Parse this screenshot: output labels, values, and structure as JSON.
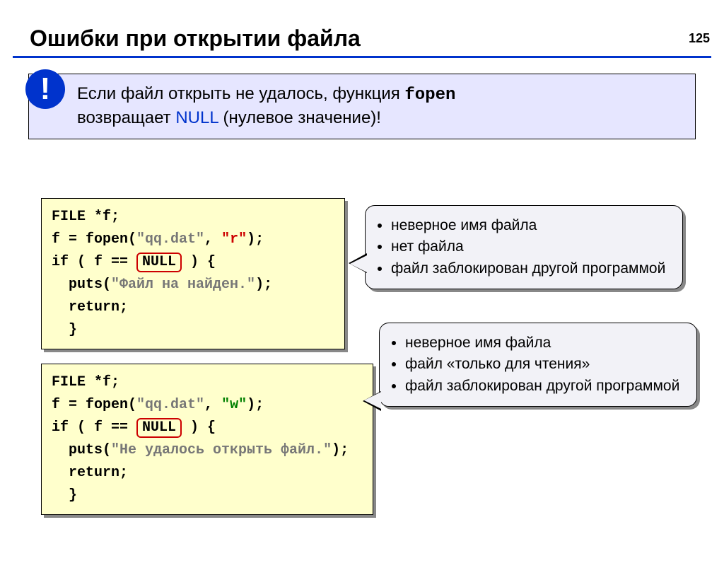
{
  "page_number": "125",
  "title": "Ошибки при открытии файла",
  "alert": {
    "badge": "!",
    "prefix": "Если файл открыть не удалось, функция ",
    "func": "fopen",
    "mid1": "возвращает ",
    "null_word": "NULL",
    "suffix": " (нулевое значение)!"
  },
  "code1": {
    "l1": "FILE *f;",
    "l2a": "f = fopen(",
    "l2q": "\"qq.dat\"",
    "l2c": ", ",
    "l2m": "\"r\"",
    "l2e": ");",
    "l3a": "if ( f == ",
    "l3n": "NULL",
    "l3e": " ) {",
    "l4a": "  puts(",
    "l4q": "\"Файл на найден.\"",
    "l4e": ");",
    "l5": "  return;",
    "l6": "  }"
  },
  "code2": {
    "l1": "FILE *f;",
    "l2a": "f = fopen(",
    "l2q": "\"qq.dat\"",
    "l2c": ", ",
    "l2m": "\"w\"",
    "l2e": ");",
    "l3a": "if ( f == ",
    "l3n": "NULL",
    "l3e": " ) {",
    "l4a": "  puts(",
    "l4q": "\"Не удалось открыть файл.\"",
    "l4e": ");",
    "l5": "  return;",
    "l6": "  }"
  },
  "callout1": {
    "items": [
      "неверное имя файла",
      "нет файла",
      "файл заблокирован другой программой"
    ]
  },
  "callout2": {
    "items": [
      "неверное имя файла",
      "файл «только для чтения»",
      "файл заблокирован другой программой"
    ]
  }
}
